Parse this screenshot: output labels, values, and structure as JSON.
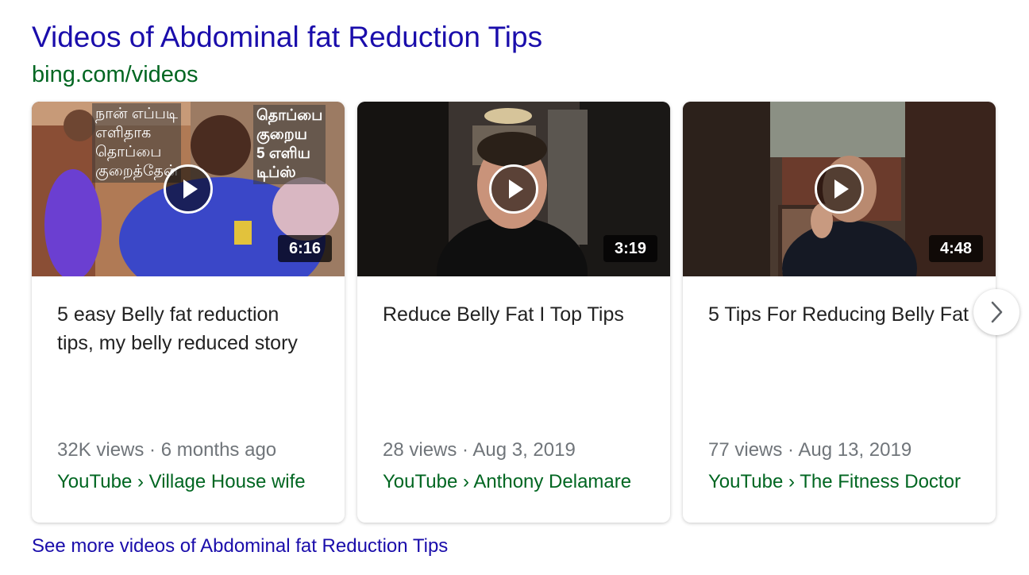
{
  "section": {
    "title": "Videos of Abdominal fat Reduction Tips",
    "source": "bing.com/videos",
    "see_more": "See more videos of Abdominal fat Reduction Tips"
  },
  "videos": [
    {
      "duration": "6:16",
      "title": "5 easy Belly fat reduction tips, my belly reduced story",
      "meta": "32K views · 6 months ago",
      "source": "YouTube › Village House wife",
      "overlay_text_left": [
        "நான் எப்படி",
        "எளிதாக",
        "தொப்பை",
        "குறைத்தேன்"
      ],
      "overlay_text_right": [
        "தொப்பை",
        "குறைய",
        "5 எளிய",
        "டிப்ஸ்"
      ]
    },
    {
      "duration": "3:19",
      "title": "Reduce Belly Fat I Top Tips",
      "meta": "28 views · Aug 3, 2019",
      "source": "YouTube › Anthony Delamare"
    },
    {
      "duration": "4:48",
      "title": "5 Tips For Reducing Belly Fat",
      "meta": "77 views · Aug 13, 2019",
      "source": "YouTube › The Fitness Doctor"
    }
  ],
  "icons": {
    "play": "play-icon",
    "next": "chevron-right-icon"
  },
  "colors": {
    "link": "#1a0dab",
    "url_green": "#006621",
    "meta_gray": "#70757a"
  }
}
